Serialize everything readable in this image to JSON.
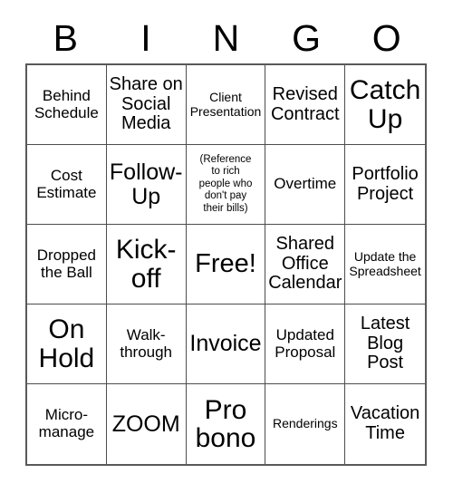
{
  "card": {
    "type": "bingo-card",
    "header_letters": [
      "B",
      "I",
      "N",
      "G",
      "O"
    ],
    "columns": 5,
    "rows": 5,
    "colors": {
      "background": "#ffffff",
      "text": "#000000",
      "grid_line": "#4d4d4d",
      "outer_border": "#595959"
    },
    "cells": [
      {
        "text": "Behind\nSchedule",
        "size": "md"
      },
      {
        "text": "Share on\nSocial\nMedia",
        "size": "lg"
      },
      {
        "text": "Client\nPresentation",
        "size": "sm"
      },
      {
        "text": "Revised\nContract",
        "size": "lg"
      },
      {
        "text": "Catch\nUp",
        "size": "xxl"
      },
      {
        "text": "Cost\nEstimate",
        "size": "md"
      },
      {
        "text": "Follow-\nUp",
        "size": "xl"
      },
      {
        "text": "(Reference\nto rich\npeople who\ndon't pay\ntheir bills)",
        "size": "xs"
      },
      {
        "text": "Overtime",
        "size": "md"
      },
      {
        "text": "Portfolio\nProject",
        "size": "lg"
      },
      {
        "text": "Dropped\nthe Ball",
        "size": "md"
      },
      {
        "text": "Kick-\noff",
        "size": "xxl"
      },
      {
        "text": "Free!",
        "size": "free"
      },
      {
        "text": "Shared\nOffice\nCalendar",
        "size": "lg"
      },
      {
        "text": "Update the\nSpreadsheet",
        "size": "sm"
      },
      {
        "text": "On\nHold",
        "size": "xxl"
      },
      {
        "text": "Walk-\nthrough",
        "size": "md"
      },
      {
        "text": "Invoice",
        "size": "xl"
      },
      {
        "text": "Updated\nProposal",
        "size": "md"
      },
      {
        "text": "Latest\nBlog\nPost",
        "size": "lg"
      },
      {
        "text": "Micro-\nmanage",
        "size": "md"
      },
      {
        "text": "ZOOM",
        "size": "xl"
      },
      {
        "text": "Pro\nbono",
        "size": "xxl"
      },
      {
        "text": "Renderings",
        "size": "sm"
      },
      {
        "text": "Vacation\nTime",
        "size": "lg"
      }
    ]
  }
}
